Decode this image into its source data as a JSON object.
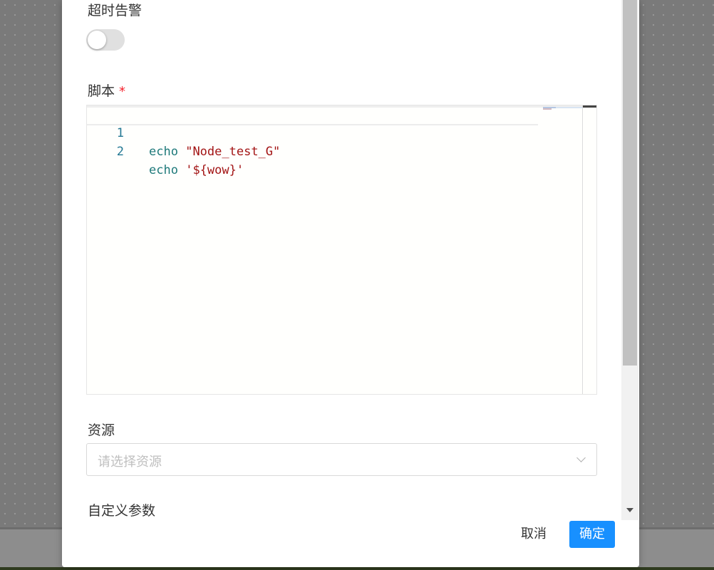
{
  "form": {
    "timeout_alert": {
      "label": "超时告警",
      "enabled": false
    },
    "script": {
      "label": "脚本",
      "required_mark": "*",
      "lines": [
        {
          "number": "1",
          "keyword": "echo",
          "argument": "\"Node_test_G\""
        },
        {
          "number": "2",
          "keyword": "echo",
          "argument": "'${wow}'"
        }
      ]
    },
    "resource": {
      "label": "资源",
      "placeholder": "请选择资源"
    },
    "custom_params": {
      "label": "自定义参数"
    }
  },
  "footer": {
    "cancel_label": "取消",
    "confirm_label": "确定"
  },
  "colors": {
    "primary": "#1890ff",
    "required": "#f5222d",
    "line_number": "#237893",
    "keyword": "#1f7a7a",
    "string": "#a31515"
  }
}
